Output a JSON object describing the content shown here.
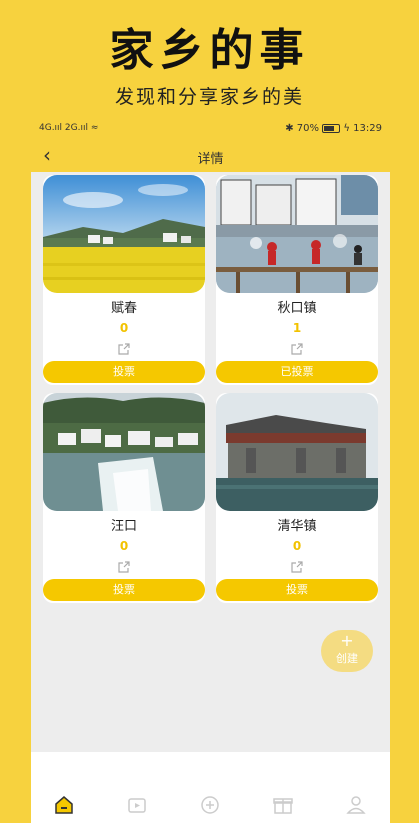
{
  "banner": {
    "title": "家乡的事",
    "subtitle": "发现和分享家乡的美"
  },
  "statusbar": {
    "left": "4G.ııl 2G.ııl ≈",
    "battery": "70%",
    "time": "13:29"
  },
  "navbar": {
    "title": "详情"
  },
  "cards": [
    {
      "name": "赋春",
      "votes": "0",
      "button": "投票"
    },
    {
      "name": "秋口镇",
      "votes": "1",
      "button": "已投票"
    },
    {
      "name": "汪口",
      "votes": "0",
      "button": "投票"
    },
    {
      "name": "清华镇",
      "votes": "0",
      "button": "投票"
    }
  ],
  "fab": {
    "plus": "+",
    "label": "创建"
  },
  "tabbar": {
    "icons": [
      "home-icon",
      "video-icon",
      "explore-icon",
      "gift-icon",
      "profile-icon"
    ]
  },
  "colors": {
    "accent": "#f7d23e",
    "button": "#f5c800",
    "vote_text": "#f2c200"
  }
}
